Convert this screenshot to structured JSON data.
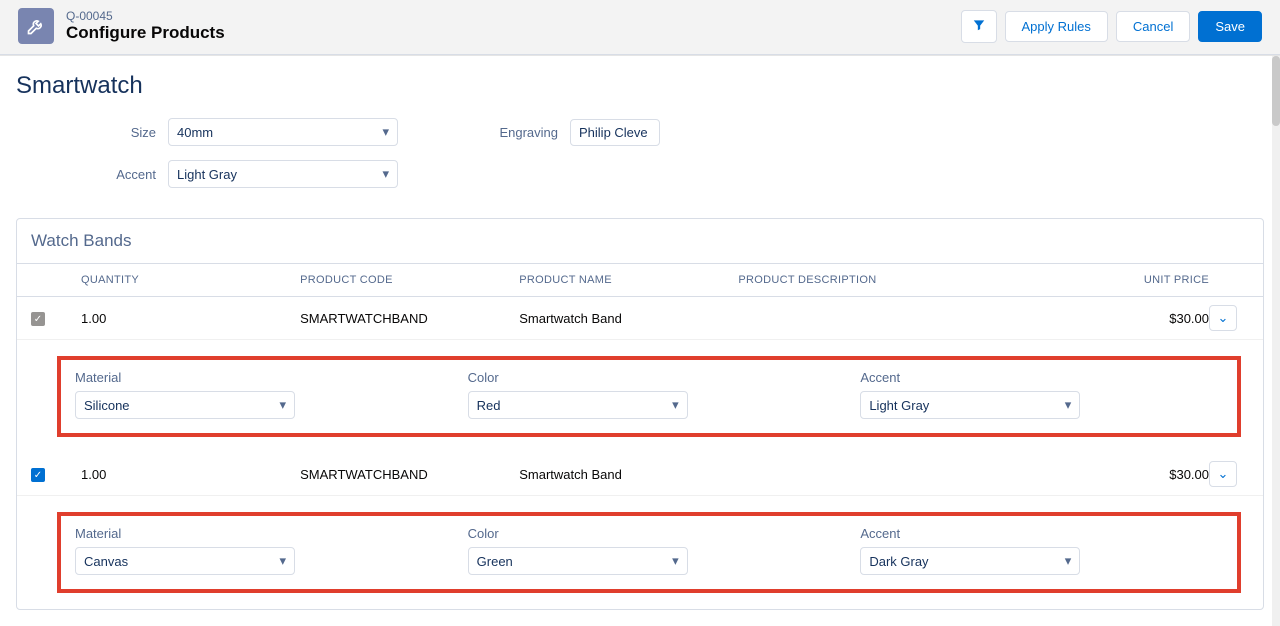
{
  "header": {
    "record_id": "Q-00045",
    "page_title": "Configure Products",
    "buttons": {
      "apply_rules": "Apply Rules",
      "cancel": "Cancel",
      "save": "Save"
    }
  },
  "product": {
    "name": "Smartwatch",
    "fields": {
      "size_label": "Size",
      "size_value": "40mm",
      "engraving_label": "Engraving",
      "engraving_value": "Philip Cleve",
      "accent_label": "Accent",
      "accent_value": "Light Gray"
    }
  },
  "bands": {
    "title": "Watch Bands",
    "columns": {
      "quantity": "QUANTITY",
      "code": "PRODUCT CODE",
      "name": "PRODUCT NAME",
      "description": "PRODUCT DESCRIPTION",
      "price": "UNIT PRICE"
    },
    "rows": [
      {
        "checked": true,
        "check_style": "disabled",
        "quantity": "1.00",
        "code": "SMARTWATCHBAND",
        "name": "Smartwatch Band",
        "description": "",
        "price": "$30.00",
        "config": {
          "material_label": "Material",
          "material_value": "Silicone",
          "color_label": "Color",
          "color_value": "Red",
          "accent_label": "Accent",
          "accent_value": "Light Gray"
        }
      },
      {
        "checked": true,
        "check_style": "active",
        "quantity": "1.00",
        "code": "SMARTWATCHBAND",
        "name": "Smartwatch Band",
        "description": "",
        "price": "$30.00",
        "config": {
          "material_label": "Material",
          "material_value": "Canvas",
          "color_label": "Color",
          "color_value": "Green",
          "accent_label": "Accent",
          "accent_value": "Dark Gray"
        }
      }
    ]
  }
}
